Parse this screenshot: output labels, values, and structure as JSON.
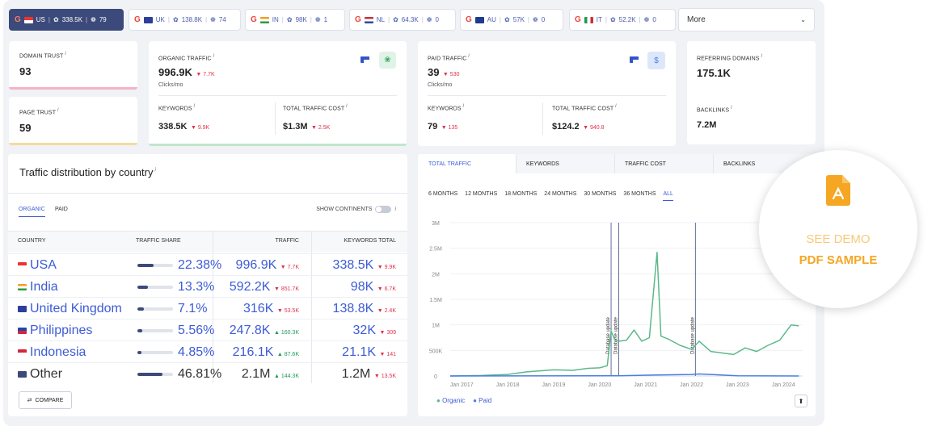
{
  "country_tabs": [
    {
      "code": "US",
      "traffic": "338.5K",
      "links": "79",
      "active": true
    },
    {
      "code": "UK",
      "traffic": "138.8K",
      "links": "74",
      "active": false
    },
    {
      "code": "IN",
      "traffic": "98K",
      "links": "1",
      "active": false
    },
    {
      "code": "NL",
      "traffic": "64.3K",
      "links": "0",
      "active": false
    },
    {
      "code": "AU",
      "traffic": "57K",
      "links": "0",
      "active": false
    },
    {
      "code": "IT",
      "traffic": "52.2K",
      "links": "0",
      "active": false
    }
  ],
  "more_label": "More",
  "domain_trust": {
    "label": "DOMAIN TRUST",
    "value": "93"
  },
  "page_trust": {
    "label": "PAGE TRUST",
    "value": "59"
  },
  "organic": {
    "label": "ORGANIC TRAFFIC",
    "value": "996.9K",
    "change": "7.7K",
    "unit": "Clicks/mo",
    "keywords_label": "KEYWORDS",
    "keywords": "338.5K",
    "keywords_change": "9.9K",
    "cost_label": "TOTAL TRAFFIC COST",
    "cost": "$1.3M",
    "cost_change": "2.5K"
  },
  "paid": {
    "label": "PAID TRAFFIC",
    "value": "39",
    "change": "530",
    "unit": "Clicks/mo",
    "keywords_label": "KEYWORDS",
    "keywords": "79",
    "keywords_change": "135",
    "cost_label": "TOTAL TRAFFIC COST",
    "cost": "$124.2",
    "cost_change": "940.8",
    "dollar": "$"
  },
  "referring": {
    "label": "REFERRING DOMAINS",
    "value": "175.1K",
    "backlinks_label": "BACKLINKS",
    "backlinks": "7.2M"
  },
  "distribution": {
    "title": "Traffic distribution by country",
    "tab_organic": "ORGANIC",
    "tab_paid": "PAID",
    "show_continents": "SHOW CONTINENTS",
    "headers": {
      "country": "COUNTRY",
      "share": "TRAFFIC SHARE",
      "traffic": "TRAFFIC",
      "keywords": "KEYWORDS TOTAL"
    },
    "rows": [
      {
        "country": "USA",
        "share": "22.38%",
        "share_frac": 0.45,
        "traffic": "996.9K",
        "tchg": "7.7K",
        "tdir": "down",
        "kw": "338.5K",
        "kchg": "9.9K",
        "kdir": "down"
      },
      {
        "country": "India",
        "share": "13.3%",
        "share_frac": 0.3,
        "traffic": "592.2K",
        "tchg": "851.7K",
        "tdir": "down",
        "kw": "98K",
        "kchg": "6.7K",
        "kdir": "down"
      },
      {
        "country": "United Kingdom",
        "share": "7.1%",
        "share_frac": 0.18,
        "traffic": "316K",
        "tchg": "53.5K",
        "tdir": "down",
        "kw": "138.8K",
        "kchg": "2.4K",
        "kdir": "down"
      },
      {
        "country": "Philippines",
        "share": "5.56%",
        "share_frac": 0.14,
        "traffic": "247.8K",
        "tchg": "160.3K",
        "tdir": "up",
        "kw": "32K",
        "kchg": "309",
        "kdir": "down"
      },
      {
        "country": "Indonesia",
        "share": "4.85%",
        "share_frac": 0.12,
        "traffic": "216.1K",
        "tchg": "87.6K",
        "tdir": "up",
        "kw": "21.1K",
        "kchg": "141",
        "kdir": "down"
      },
      {
        "country": "Other",
        "share": "46.81%",
        "share_frac": 0.7,
        "traffic": "2.1M",
        "tchg": "144.3K",
        "tdir": "up",
        "kw": "1.2M",
        "kchg": "13.5K",
        "kdir": "down"
      }
    ],
    "compare": "COMPARE"
  },
  "chart_tabs": [
    "TOTAL TRAFFIC",
    "KEYWORDS",
    "TRAFFIC COST",
    "BACKLINKS"
  ],
  "ranges": [
    "6 MONTHS",
    "12 MONTHS",
    "18 MONTHS",
    "24 MONTHS",
    "30 MONTHS",
    "36 MONTHS",
    "ALL"
  ],
  "demo": {
    "line1": "SEE DEMO",
    "line2": "PDF SAMPLE"
  },
  "colors": {
    "organic": "#5cb88a",
    "paid": "#4a7fe0",
    "accent": "#3d5bd6",
    "down": "#e0314b",
    "up": "#1f9a5b",
    "demo": "#f5a623"
  },
  "chart_data": {
    "type": "line",
    "x_ticks": [
      "Jan 2017",
      "Jan 2018",
      "Jan 2019",
      "Jan 2020",
      "Jan 2021",
      "Jan 2022",
      "Jan 2023",
      "Jan 2024"
    ],
    "y_ticks": [
      "0",
      "500K",
      "1M",
      "1.5M",
      "2M",
      "2.5M",
      "3M"
    ],
    "ylim": [
      0,
      3000000
    ],
    "annotations": [
      {
        "date": "2020-04",
        "text": "Database update"
      },
      {
        "date": "2020-06",
        "text": "Database update"
      },
      {
        "date": "2022-02",
        "text": "Database update"
      }
    ],
    "series": [
      {
        "name": "Organic",
        "color": "#5cb88a",
        "points": [
          [
            "2016-10",
            0
          ],
          [
            "2017-06",
            10000
          ],
          [
            "2018-01",
            30000
          ],
          [
            "2018-06",
            80000
          ],
          [
            "2019-01",
            120000
          ],
          [
            "2019-06",
            110000
          ],
          [
            "2019-10",
            150000
          ],
          [
            "2020-01",
            160000
          ],
          [
            "2020-03",
            200000
          ],
          [
            "2020-04",
            880000
          ],
          [
            "2020-05",
            700000
          ],
          [
            "2020-06",
            680000
          ],
          [
            "2020-08",
            700000
          ],
          [
            "2020-10",
            900000
          ],
          [
            "2020-12",
            680000
          ],
          [
            "2021-02",
            750000
          ],
          [
            "2021-04",
            2420000
          ],
          [
            "2021-05",
            780000
          ],
          [
            "2021-07",
            720000
          ],
          [
            "2021-10",
            600000
          ],
          [
            "2022-01",
            520000
          ],
          [
            "2022-03",
            680000
          ],
          [
            "2022-06",
            480000
          ],
          [
            "2022-09",
            450000
          ],
          [
            "2022-12",
            420000
          ],
          [
            "2023-03",
            550000
          ],
          [
            "2023-06",
            480000
          ],
          [
            "2023-09",
            600000
          ],
          [
            "2023-12",
            700000
          ],
          [
            "2024-03",
            1000000
          ],
          [
            "2024-05",
            980000
          ]
        ]
      },
      {
        "name": "Paid",
        "color": "#4a7fe0",
        "points": [
          [
            "2016-10",
            0
          ],
          [
            "2020-06",
            5000
          ],
          [
            "2021-04",
            20000
          ],
          [
            "2022-01",
            30000
          ],
          [
            "2022-03",
            40000
          ],
          [
            "2023-01",
            5000
          ],
          [
            "2024-05",
            0
          ]
        ]
      }
    ]
  }
}
